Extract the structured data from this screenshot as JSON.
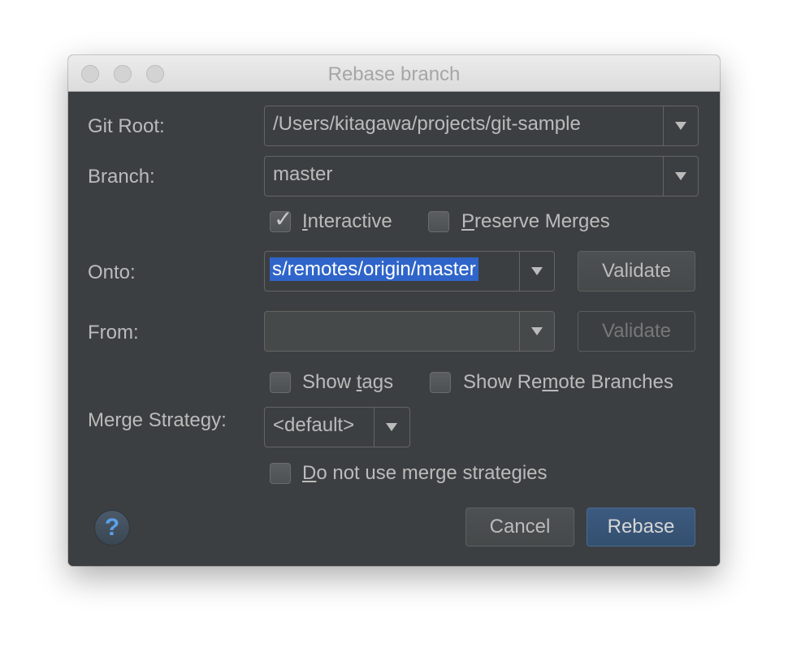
{
  "window": {
    "title": "Rebase branch"
  },
  "fields": {
    "git_root": {
      "label": "Git Root:",
      "value": "/Users/kitagawa/projects/git-sample"
    },
    "branch": {
      "label": "Branch:",
      "value": "master"
    },
    "onto": {
      "label": "Onto:",
      "value": "s/remotes/origin/master",
      "validate_label": "Validate"
    },
    "from": {
      "label": "From:",
      "value": "",
      "validate_label": "Validate"
    },
    "merge_strategy": {
      "label": "Merge Strategy:",
      "value": "<default>"
    }
  },
  "checkboxes": {
    "interactive": {
      "pre": "",
      "mnemonic": "I",
      "post": "nteractive",
      "checked": true
    },
    "preserve_merges": {
      "pre": "",
      "mnemonic": "P",
      "post": "reserve Merges",
      "checked": false
    },
    "show_tags": {
      "pre": "Show ",
      "mnemonic": "t",
      "post": "ags",
      "checked": false
    },
    "show_remote_branches": {
      "pre": "Show Re",
      "mnemonic": "m",
      "post": "ote Branches",
      "checked": false
    },
    "no_merge_strategies": {
      "pre": "",
      "mnemonic": "D",
      "post": "o not use merge strategies",
      "checked": false
    }
  },
  "buttons": {
    "cancel": "Cancel",
    "rebase": "Rebase",
    "help": "?"
  },
  "colors": {
    "background": "#3c3f41",
    "selection": "#2f65ca",
    "primary_button": "#365880"
  }
}
